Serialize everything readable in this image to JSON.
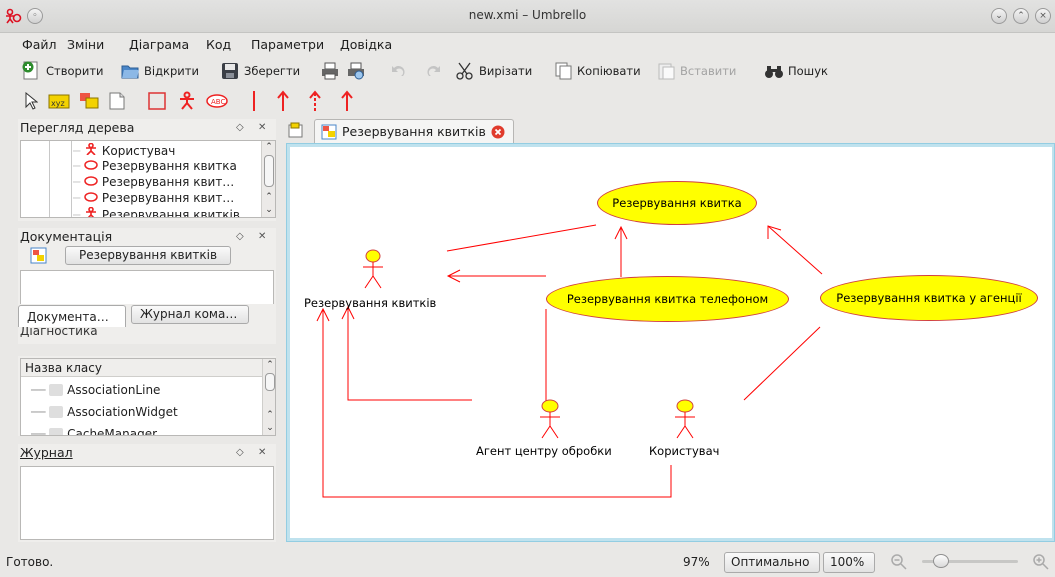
{
  "window": {
    "title": "new.xmi – Umbrello"
  },
  "menu": {
    "file": "Файл",
    "edit": "Зміни",
    "diagram": "Діаграма",
    "code": "Код",
    "settings": "Параметри",
    "help": "Довідка"
  },
  "toolbar": {
    "new_label": "Створити",
    "open_label": "Відкрити",
    "save_label": "Зберегти",
    "cut_label": "Вирізати",
    "copy_label": "Копіювати",
    "paste_label": "Вставити",
    "find_label": "Пошук"
  },
  "palette": {
    "tools": [
      "select-arrow-icon",
      "text-line-icon",
      "note-icon",
      "anchor-icon",
      "box-icon",
      "actor-icon",
      "usecase-icon",
      "association-icon",
      "generalization-icon",
      "dependency-icon",
      "uni-association-icon"
    ]
  },
  "tree_panel": {
    "title": "Перегляд дерева",
    "items": [
      {
        "label": "Користувач",
        "icon": "actor-icon"
      },
      {
        "label": "Резервування квитка",
        "icon": "usecase-icon"
      },
      {
        "label": "Резервування квит…",
        "icon": "usecase-icon"
      },
      {
        "label": "Резервування квит…",
        "icon": "usecase-icon"
      },
      {
        "label": "Резервування квитків",
        "icon": "actor-icon"
      }
    ]
  },
  "doc_panel": {
    "title": "Документація",
    "object_name": "Резервування квитків",
    "tab_doc": "Документа…",
    "tab_log": "Журнал кома…",
    "diag_title": "Діагностика"
  },
  "class_panel": {
    "header": "Назва класу",
    "items": [
      "AssociationLine",
      "AssociationWidget",
      "CacheManager"
    ]
  },
  "log_panel": {
    "title": "Журнал"
  },
  "tabs": {
    "active_label": "Резервування квитків"
  },
  "diagram": {
    "usecases": {
      "uc1": "Резервування квитка",
      "uc2": "Резервування квитка телефоном",
      "uc3": "Резервування квитка у агенції"
    },
    "actors": {
      "a1": "Резервування квитків",
      "a2": "Агент центру обробки",
      "a3": "Користувач"
    },
    "colors": {
      "usecase_fill": "#ffff00",
      "line": "#ff0000"
    }
  },
  "statusbar": {
    "status": "Готово.",
    "zoom": "97%",
    "optimal": "Оптимально",
    "hundred": "100%"
  }
}
